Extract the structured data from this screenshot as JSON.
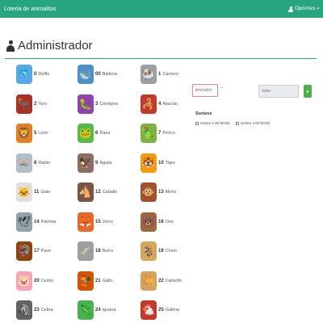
{
  "navbar": {
    "brand": "Loteria de animalitos",
    "options_label": "Opciones",
    "bg_color": "#26a57f"
  },
  "page": {
    "title": "Administrador"
  },
  "animals": [
    {
      "num": "0",
      "name": "Delfin",
      "icon": "dolphin-icon",
      "glyph": "🐬",
      "bg": "#5aa9e6"
    },
    {
      "num": "00",
      "name": "Ballena",
      "icon": "whale-icon",
      "glyph": "🐋",
      "bg": "#4f8fc7"
    },
    {
      "num": "1",
      "name": "Carnero",
      "icon": "ram-icon",
      "glyph": "🐏",
      "bg": "#9aa0a6"
    },
    {
      "num": "2",
      "name": "Toro",
      "icon": "bull-icon",
      "glyph": "🐂",
      "bg": "#a93226"
    },
    {
      "num": "3",
      "name": "Ciempies",
      "icon": "centipede-icon",
      "glyph": "🐛",
      "bg": "#8e44ad"
    },
    {
      "num": "4",
      "name": "Alacrán",
      "icon": "scorpion-icon",
      "glyph": "🦂",
      "bg": "#c0392b"
    },
    {
      "num": "5",
      "name": "León",
      "icon": "lion-icon",
      "glyph": "🦁",
      "bg": "#e67e22"
    },
    {
      "num": "6",
      "name": "Rana",
      "icon": "frog-icon",
      "glyph": "🐸",
      "bg": "#58b947"
    },
    {
      "num": "7",
      "name": "Perico",
      "icon": "parrot-icon",
      "glyph": "🦜",
      "bg": "#7cb342"
    },
    {
      "num": "8",
      "name": "Ratón",
      "icon": "mouse-icon",
      "glyph": "🐭",
      "bg": "#b0bec5"
    },
    {
      "num": "9",
      "name": "Águila",
      "icon": "eagle-icon",
      "glyph": "🦅",
      "bg": "#8d6e63"
    },
    {
      "num": "10",
      "name": "Tigre",
      "icon": "tiger-icon",
      "glyph": "🐯",
      "bg": "#f39c12"
    },
    {
      "num": "11",
      "name": "Gato",
      "icon": "cat-icon",
      "glyph": "🐱",
      "bg": "#e0e0e0"
    },
    {
      "num": "12",
      "name": "Caballo",
      "icon": "horse-icon",
      "glyph": "🐴",
      "bg": "#795548"
    },
    {
      "num": "13",
      "name": "Mono",
      "icon": "monkey-icon",
      "glyph": "🐵",
      "bg": "#a0522d"
    },
    {
      "num": "14",
      "name": "Paloma",
      "icon": "dove-icon",
      "glyph": "🕊",
      "bg": "#90a4ae"
    },
    {
      "num": "15",
      "name": "Zorro",
      "icon": "fox-icon",
      "glyph": "🦊",
      "bg": "#e8672c"
    },
    {
      "num": "16",
      "name": "Oso",
      "icon": "bear-icon",
      "glyph": "🐻",
      "bg": "#a0673a"
    },
    {
      "num": "17",
      "name": "Pavo",
      "icon": "turkey-icon",
      "glyph": "🦃",
      "bg": "#8b4513"
    },
    {
      "num": "18",
      "name": "Burro",
      "icon": "donkey-icon",
      "glyph": "🫏",
      "bg": "#9e9e9e"
    },
    {
      "num": "19",
      "name": "Chivo",
      "icon": "goat-icon",
      "glyph": "🐐",
      "bg": "#d4a95f"
    },
    {
      "num": "20",
      "name": "Cerdo",
      "icon": "pig-icon",
      "glyph": "🐷",
      "bg": "#f4a6b8"
    },
    {
      "num": "21",
      "name": "Gallo",
      "icon": "rooster-icon",
      "glyph": "🐓",
      "bg": "#d35400"
    },
    {
      "num": "22",
      "name": "Camello",
      "icon": "camel-icon",
      "glyph": "🐫",
      "bg": "#d2a35c"
    },
    {
      "num": "23",
      "name": "Cebra",
      "icon": "zebra-icon",
      "glyph": "🦓",
      "bg": "#616161"
    },
    {
      "num": "24",
      "name": "Iguana",
      "icon": "iguana-icon",
      "glyph": "🦎",
      "bg": "#4caf50"
    },
    {
      "num": "25",
      "name": "Gallina",
      "icon": "hen-icon",
      "glyph": "🐔",
      "bg": "#c0392b"
    }
  ],
  "form": {
    "animal_placeholder": "Animalito",
    "dash": "-",
    "valor_placeholder": "Valor",
    "add_label": "+"
  },
  "sorteos": {
    "title": "Sorteos",
    "items": [
      {
        "label": "Sorteo 1-02:00:00"
      },
      {
        "label": "Sorteo 2-03:00:00"
      }
    ]
  }
}
